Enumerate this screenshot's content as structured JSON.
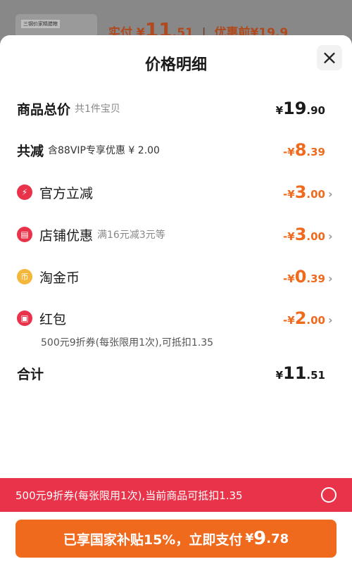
{
  "background": {
    "thumb_label": "三钢价家精腊粮",
    "paid_prefix": "实付",
    "paid_currency": "¥",
    "paid_int": "11",
    "paid_dec": ".51",
    "before_label": "优惠前",
    "before_value": "¥19.9"
  },
  "sheet": {
    "title": "价格明细",
    "close_icon": "×"
  },
  "rows": {
    "total": {
      "label": "商品总价",
      "sub": "共1件宝贝",
      "cur": "¥",
      "int": "19",
      "dec": ".90"
    },
    "reduce": {
      "label": "共减",
      "sub": "含88VIP专享优惠 ¥ 2.00",
      "cur": "-¥",
      "int": "8",
      "dec": ".39"
    },
    "official": {
      "label": "官方立减",
      "icon": "lightning-icon",
      "cur": "-¥",
      "int": "3",
      "dec": ".00"
    },
    "store": {
      "label": "店铺优惠",
      "icon": "store-icon",
      "sub": "满16元减3元等",
      "cur": "-¥",
      "int": "3",
      "dec": ".00"
    },
    "coins": {
      "label": "淘金币",
      "icon": "coin-icon",
      "cur": "-¥",
      "int": "0",
      "dec": ".39"
    },
    "redpacket": {
      "label": "红包",
      "icon": "red-packet-icon",
      "cur": "-¥",
      "int": "2",
      "dec": ".00",
      "note": "500元9折券(每张限用1次),可抵扣1.35"
    },
    "sum": {
      "label": "合计",
      "cur": "¥",
      "int": "11",
      "dec": ".51"
    }
  },
  "coupon_bar": {
    "text": "500元9折券(每张限用1次),当前商品可抵扣1.35"
  },
  "pay_button": {
    "label": "已享国家补贴15%，立即支付",
    "cur": "¥",
    "int": "9",
    "dec": ".78"
  },
  "colors": {
    "accent_orange": "#f06a1e",
    "accent_red": "#e8334a"
  }
}
